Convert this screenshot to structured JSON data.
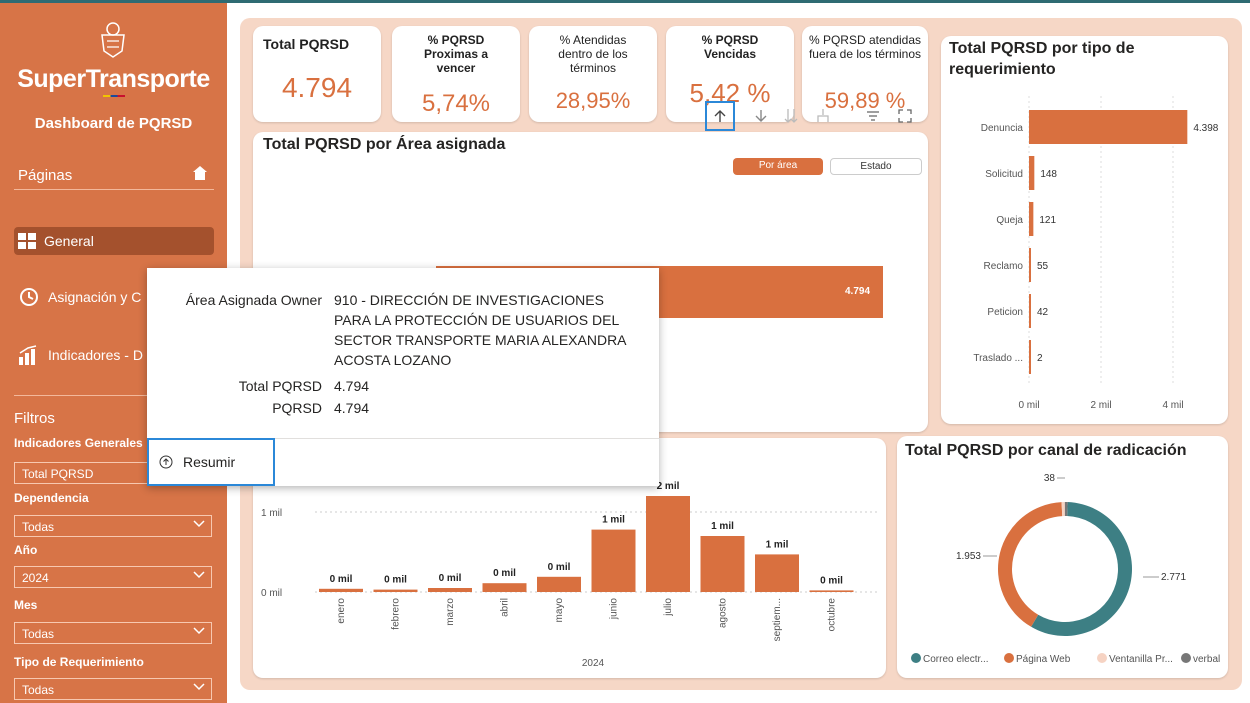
{
  "sidebar": {
    "logo": "SuperTransporte",
    "dashboard_title": "Dashboard de PQRSD",
    "pages_label": "Páginas",
    "nav": [
      {
        "label": "General"
      },
      {
        "label": "Asignación y C"
      },
      {
        "label": "Indicadores - D"
      }
    ],
    "filters_label": "Filtros",
    "filters": [
      {
        "label": "Indicadores Generales",
        "value": "Total PQRSD"
      },
      {
        "label": "Dependencia",
        "value": "Todas"
      },
      {
        "label": "Año",
        "value": "2024"
      },
      {
        "label": "Mes",
        "value": "Todas"
      },
      {
        "label": "Tipo de Requerimiento",
        "value": "Todas"
      }
    ]
  },
  "kpis": [
    {
      "title": "Total PQRSD",
      "value": "4.794"
    },
    {
      "title": "% PQRSD Proximas a vencer",
      "value": "5,74%"
    },
    {
      "title": "% Atendidas dentro de los términos",
      "value": "28,95%"
    },
    {
      "title": "% PQRSD Vencidas",
      "value": "5,42 %"
    },
    {
      "title": "% PQRSD atendidas fuera de los términos",
      "value": "59,89 %"
    }
  ],
  "area_card": {
    "title": "Total PQRSD por Área asignada",
    "toggle_active": "Por área",
    "toggle_inactive": "Estado",
    "bar_label": "4.794"
  },
  "tooltip": {
    "rows": [
      {
        "key": "Área Asignada Owner",
        "value": "910 - DIRECCIÓN DE INVESTIGACIONES PARA LA PROTECCIÓN DE USUARIOS DEL SECTOR TRANSPORTE MARIA ALEXANDRA ACOSTA LOZANO"
      },
      {
        "key": "Total PQRSD",
        "value": "4.794"
      },
      {
        "key": "PQRSD",
        "value": "4.794"
      }
    ],
    "action": "Resumir"
  },
  "colors": {
    "accent": "#d77447",
    "bar": "#d9703f",
    "teal": "#3d7f84",
    "highlight": "#2b88d8"
  },
  "chart_data": [
    {
      "type": "bar",
      "title": "Total PQRSD por tipo de requerimiento",
      "orientation": "horizontal",
      "categories": [
        "Denuncia",
        "Solicitud",
        "Queja",
        "Reclamo",
        "Peticion",
        "Traslado ..."
      ],
      "values": [
        4398,
        148,
        121,
        55,
        42,
        2
      ],
      "value_labels": [
        "4.398",
        "148",
        "121",
        "55",
        "42",
        "2"
      ],
      "x_ticks": [
        "0 mil",
        "2 mil",
        "4 mil"
      ],
      "xlim": [
        0,
        5000
      ]
    },
    {
      "type": "bar",
      "title": "",
      "xlabel": "2024",
      "categories": [
        "enero",
        "febrero",
        "marzo",
        "abril",
        "mayo",
        "junio",
        "julio",
        "agosto",
        "septiem...",
        "octubre"
      ],
      "values": [
        40,
        30,
        50,
        110,
        190,
        780,
        1200,
        700,
        470,
        20
      ],
      "value_labels": [
        "0 mil",
        "0 mil",
        "0 mil",
        "0 mil",
        "0 mil",
        "1 mil",
        "2 mil",
        "1 mil",
        "1 mil",
        "0 mil"
      ],
      "y_ticks": [
        "0 mil",
        "1 mil"
      ],
      "ylim": [
        0,
        1500
      ]
    },
    {
      "type": "pie",
      "title": "Total PQRSD por canal de radicación",
      "categories": [
        "Correo electr...",
        "Página Web",
        "Ventanilla Pr...",
        "verbal"
      ],
      "values": [
        2771,
        1953,
        38,
        32
      ],
      "value_labels": [
        "2.771",
        "1.953",
        "38",
        ""
      ],
      "colors": [
        "#3d7f84",
        "#d9703f",
        "#f6d3c3",
        "#777777"
      ]
    }
  ]
}
